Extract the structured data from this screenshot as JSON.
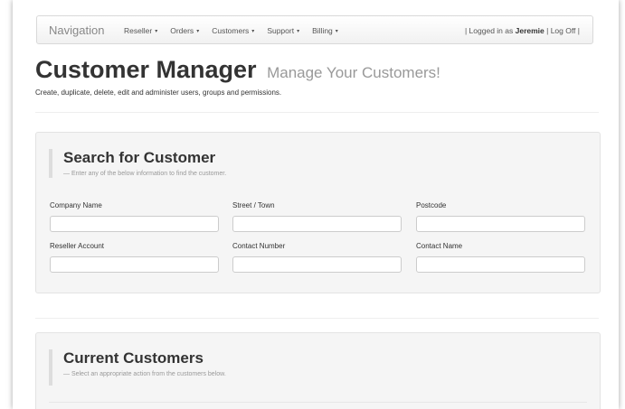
{
  "nav": {
    "brand": "Navigation",
    "items": [
      {
        "label": "Reseller"
      },
      {
        "label": "Orders"
      },
      {
        "label": "Customers"
      },
      {
        "label": "Support"
      },
      {
        "label": "Billing"
      }
    ],
    "caret": "▾",
    "user_prefix": "| Logged in as",
    "user_name": "Jeremie",
    "logoff": "| Log Off |"
  },
  "header": {
    "title": "Customer Manager",
    "subtitle": "Manage Your Customers!",
    "description": "Create, duplicate, delete, edit and administer users, groups and permissions."
  },
  "search": {
    "title": "Search for Customer",
    "subtitle": "— Enter any of the below information to find the customer.",
    "fields": [
      {
        "label": "Company Name",
        "value": ""
      },
      {
        "label": "Street / Town",
        "value": ""
      },
      {
        "label": "Postcode",
        "value": ""
      },
      {
        "label": "Reseller Account",
        "value": ""
      },
      {
        "label": "Contact Number",
        "value": ""
      },
      {
        "label": "Contact Name",
        "value": ""
      }
    ]
  },
  "customers": {
    "title": "Current Customers",
    "subtitle": "— Select an appropriate action from the customers below."
  }
}
